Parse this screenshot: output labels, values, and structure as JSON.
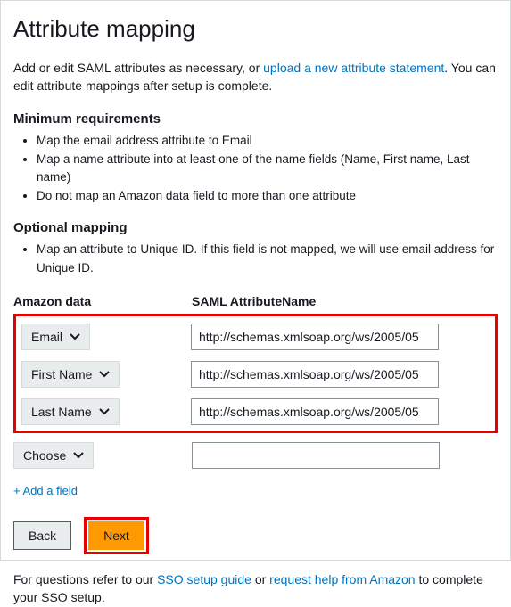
{
  "title": "Attribute mapping",
  "intro": {
    "prefix": "Add or edit SAML attributes as necessary, or ",
    "link": "upload a new attribute statement",
    "suffix": ". You can edit attribute mappings after setup is complete."
  },
  "min_req": {
    "title": "Minimum requirements",
    "items": [
      "Map the email address attribute to Email",
      "Map a name attribute into at least one of the name fields (Name, First name, Last name)",
      "Do not map an Amazon data field to more than one attribute"
    ]
  },
  "opt_map": {
    "title": "Optional mapping",
    "items": [
      "Map an attribute to Unique ID. If this field is not mapped, we will use email address for Unique ID."
    ]
  },
  "columns": {
    "left": "Amazon data",
    "right": "SAML AttributeName"
  },
  "rows": [
    {
      "label": "Email",
      "value": "http://schemas.xmlsoap.org/ws/2005/05"
    },
    {
      "label": "First Name",
      "value": "http://schemas.xmlsoap.org/ws/2005/05"
    },
    {
      "label": "Last Name",
      "value": "http://schemas.xmlsoap.org/ws/2005/05"
    }
  ],
  "choose_row": {
    "label": "Choose",
    "value": ""
  },
  "add_field": "+ Add a field",
  "buttons": {
    "back": "Back",
    "next": "Next"
  },
  "footer": {
    "p1": "For questions refer to our ",
    "l1": "SSO setup guide",
    "p2": " or ",
    "l2": "request help from Amazon",
    "p3": " to complete your SSO setup."
  }
}
